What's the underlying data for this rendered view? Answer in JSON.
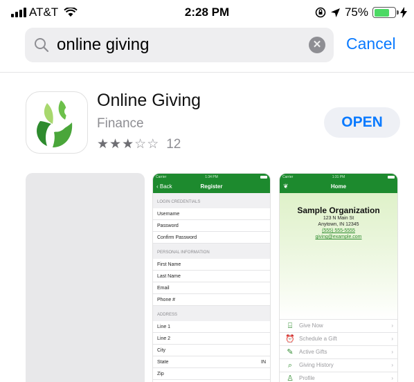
{
  "status_bar": {
    "carrier": "AT&T",
    "time": "2:28 PM",
    "battery": "75%",
    "battery_level": 0.75
  },
  "search": {
    "query": "online giving",
    "cancel_label": "Cancel"
  },
  "app": {
    "name": "Online Giving",
    "category": "Finance",
    "rating_stars": 3,
    "rating_max": 5,
    "rating_count": "12",
    "open_label": "OPEN",
    "icon_colors": [
      "#2e8b2e",
      "#6cc04a",
      "#a8d86e"
    ]
  },
  "screenshots": {
    "register": {
      "status_carrier": "Carrier",
      "status_time": "1:34 PM",
      "back_label": "Back",
      "title": "Register",
      "sections": [
        {
          "header": "LOGIN CREDENTIALS",
          "rows": [
            {
              "label": "Username"
            },
            {
              "label": "Password"
            },
            {
              "label": "Confirm Password"
            }
          ]
        },
        {
          "header": "PERSONAL INFORMATION",
          "rows": [
            {
              "label": "First Name"
            },
            {
              "label": "Last Name"
            },
            {
              "label": "Email"
            },
            {
              "label": "Phone #"
            }
          ]
        },
        {
          "header": "ADDRESS",
          "rows": [
            {
              "label": "Line 1"
            },
            {
              "label": "Line 2"
            },
            {
              "label": "City"
            },
            {
              "label": "State",
              "value": "IN"
            },
            {
              "label": "Zip"
            }
          ]
        }
      ]
    },
    "home": {
      "status_carrier": "Carrier",
      "status_time": "1:31 PM",
      "title": "Home",
      "org_name": "Sample Organization",
      "address_line1": "123 N Main St",
      "address_line2": "Anytown, IN 12345",
      "phone": "(555) 555-5555",
      "email": "giving@example.com",
      "menu": [
        {
          "label": "Give Now",
          "icon": "gift-icon"
        },
        {
          "label": "Schedule a Gift",
          "icon": "alarm-clock-icon"
        },
        {
          "label": "Active Gifts",
          "icon": "pen-icon"
        },
        {
          "label": "Giving History",
          "icon": "search-icon"
        },
        {
          "label": "Profile",
          "icon": "person-icon"
        }
      ]
    }
  },
  "colors": {
    "accent_blue": "#0a7aff",
    "app_green": "#1d8a2e",
    "battery_green": "#4cd964"
  }
}
